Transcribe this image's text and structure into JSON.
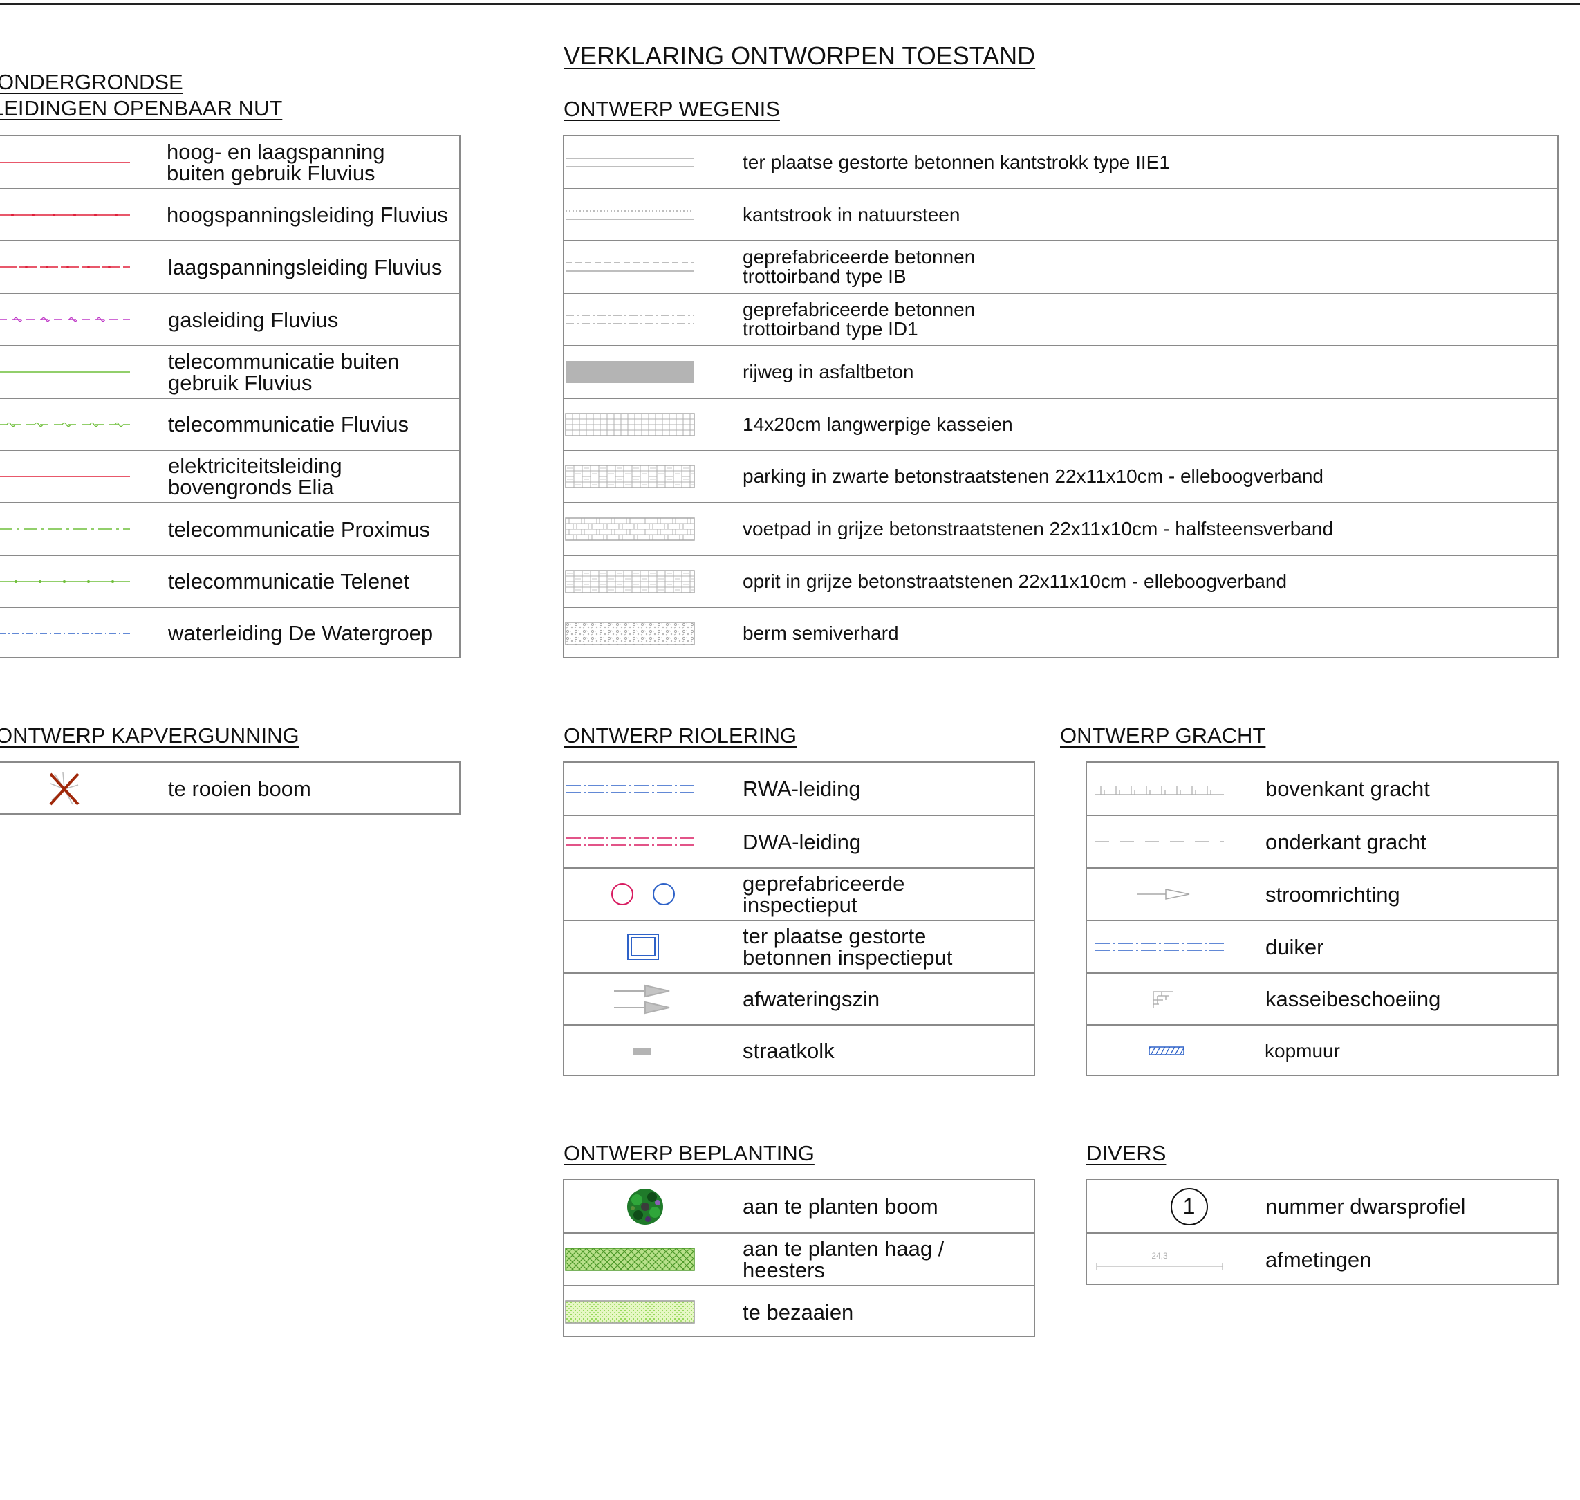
{
  "colors": {
    "red": "#e0203a",
    "pink": "#d81b60",
    "magenta": "#c03ac8",
    "green": "#6fbf3a",
    "blue": "#2e62c8",
    "grey": "#9a9a9a",
    "asphalt": "#b4b4b4",
    "tree_x": "#a0280a"
  },
  "legend_title": "VERKLARING ONTWORPEN TOESTAND",
  "ondergronds": {
    "title_line1": "ONDERGRONDSE",
    "title_line2": "LEIDINGEN OPENBAAR NUT",
    "rows": [
      {
        "label": "hoog- en laagspanning\nbuiten gebruik Fluvius",
        "icon": "thin-red-line"
      },
      {
        "label": "hoogspanningsleiding Fluvius",
        "icon": "red-dotted-line"
      },
      {
        "label": "laagspanningsleiding Fluvius",
        "icon": "red-dashed-line"
      },
      {
        "label": "gasleiding Fluvius",
        "icon": "magenta-gas-line"
      },
      {
        "label": "telecommunicatie buiten\ngebruik Fluvius",
        "icon": "thin-green-line"
      },
      {
        "label": "telecommunicatie Fluvius",
        "icon": "green-wavy-line"
      },
      {
        "label": "elektriciteitsleiding\nbovengronds Elia",
        "icon": "thin-red-line"
      },
      {
        "label": "telecommunicatie Proximus",
        "icon": "green-dashed-line"
      },
      {
        "label": "telecommunicatie Telenet",
        "icon": "green-dotted-line"
      },
      {
        "label": "waterleiding De Watergroep",
        "icon": "blue-dash-dot-line"
      }
    ]
  },
  "kap": {
    "title": "ONTWERP KAPVERGUNNING",
    "rows": [
      {
        "label": "te rooien boom",
        "icon": "tree-cross-icon"
      }
    ]
  },
  "wegenis": {
    "title": "ONTWERP WEGENIS",
    "rows": [
      {
        "label": "ter plaatse gestorte betonnen kantstrokk type IIE1",
        "icon": "double-line"
      },
      {
        "label": "kantstrook in natuursteen",
        "icon": "dotted-double-line"
      },
      {
        "label": "geprefabriceerde betonnen\ntrottoirband type IB",
        "icon": "dashed-double-line"
      },
      {
        "label": "geprefabriceerde betonnen\ntrottoirband type ID1",
        "icon": "dashdot-double-line"
      },
      {
        "label": "rijweg in asfaltbeton",
        "icon": "asphalt-fill"
      },
      {
        "label": "14x20cm langwerpige kasseien",
        "icon": "cobble-grid"
      },
      {
        "label": "parking in zwarte betonstraatstenen 22x11x10cm - elleboogverband",
        "icon": "herringbone-hatch"
      },
      {
        "label": "voetpad in grijze betonstraatstenen 22x11x10cm - halfsteensverband",
        "icon": "halfsteens-hatch"
      },
      {
        "label": "oprit in grijze betonstraatstenen 22x11x10cm - elleboogverband",
        "icon": "herringbone-hatch"
      },
      {
        "label": "berm semiverhard",
        "icon": "gravel-hatch"
      }
    ]
  },
  "riolering": {
    "title": "ONTWERP RIOLERING",
    "rows": [
      {
        "label": "RWA-leiding",
        "icon": "blue-double-dashdot"
      },
      {
        "label": "DWA-leiding",
        "icon": "red-double-dashdot"
      },
      {
        "label": "geprefabriceerde\ninspectieput",
        "icon": "two-circles-icon"
      },
      {
        "label": "ter plaatse gestorte\nbetonnen inspectieput",
        "icon": "square-manhole-icon"
      },
      {
        "label": "afwateringszin",
        "icon": "double-arrow-icon"
      },
      {
        "label": "straatkolk",
        "icon": "gully-icon"
      }
    ]
  },
  "gracht": {
    "title": "ONTWERP GRACHT",
    "rows": [
      {
        "label": "bovenkant gracht",
        "icon": "ditch-top-line"
      },
      {
        "label": "onderkant gracht",
        "icon": "ditch-bottom-dashes"
      },
      {
        "label": "stroomrichting",
        "icon": "flow-arrow-icon"
      },
      {
        "label": "duiker",
        "icon": "blue-double-dashdot"
      },
      {
        "label": "kasseibeschoeiing",
        "icon": "cobble-revetment-icon"
      },
      {
        "label": "kopmuur",
        "icon": "headwall-icon"
      }
    ]
  },
  "beplanting": {
    "title": "ONTWERP BEPLANTING",
    "rows": [
      {
        "label": "aan te planten boom",
        "icon": "tree-icon"
      },
      {
        "label": "aan te planten haag /\nheesters",
        "icon": "hedge-hatch"
      },
      {
        "label": "te bezaaien",
        "icon": "seed-hatch"
      }
    ]
  },
  "divers": {
    "title": "DIVERS",
    "rows": [
      {
        "label": "nummer dwarsprofiel",
        "icon": "section-number-icon",
        "symbol_text": "1"
      },
      {
        "label": "afmetingen",
        "icon": "dimension-icon",
        "symbol_text": "24,3"
      }
    ]
  }
}
